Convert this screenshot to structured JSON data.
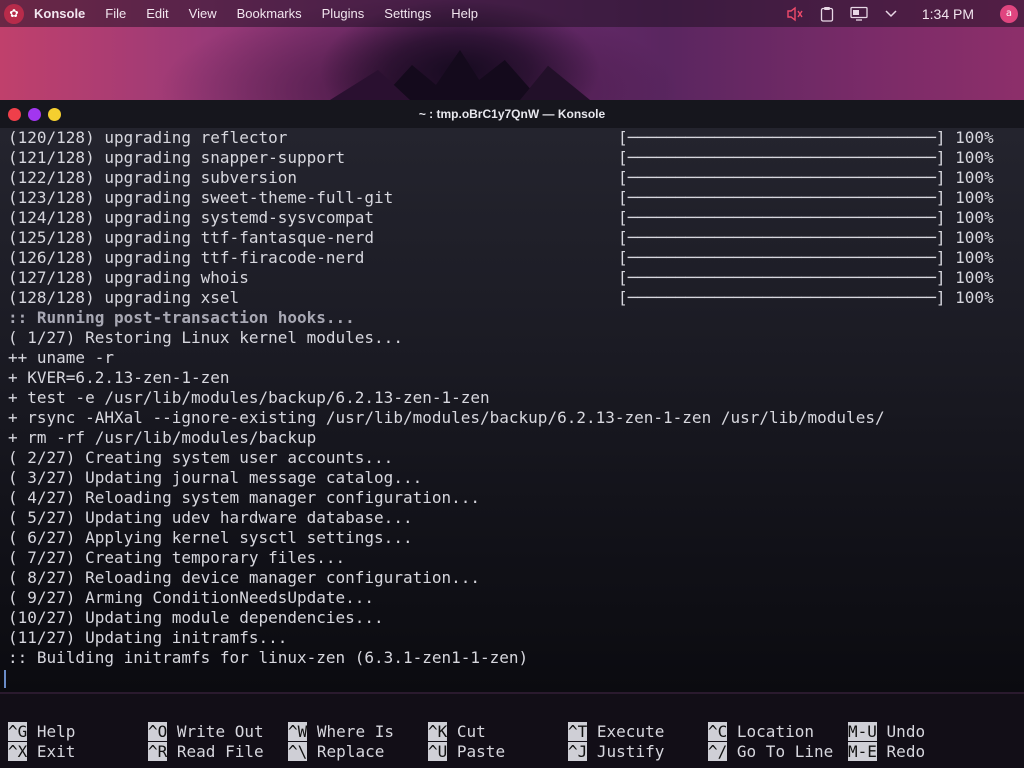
{
  "panel": {
    "app_name": "Konsole",
    "menu": [
      "File",
      "Edit",
      "View",
      "Bookmarks",
      "Plugins",
      "Settings",
      "Help"
    ],
    "clock": "1:34 PM",
    "avatar_letter": "a"
  },
  "window": {
    "title": "~ : tmp.oBrC1y7QnW — Konsole"
  },
  "terminal": {
    "upgrade_lines": [
      {
        "text": "(120/128) upgrading reflector",
        "percent": "100%"
      },
      {
        "text": "(121/128) upgrading snapper-support",
        "percent": "100%"
      },
      {
        "text": "(122/128) upgrading subversion",
        "percent": "100%"
      },
      {
        "text": "(123/128) upgrading sweet-theme-full-git",
        "percent": "100%"
      },
      {
        "text": "(124/128) upgrading systemd-sysvcompat",
        "percent": "100%"
      },
      {
        "text": "(125/128) upgrading ttf-fantasque-nerd",
        "percent": "100%"
      },
      {
        "text": "(126/128) upgrading ttf-firacode-nerd",
        "percent": "100%"
      },
      {
        "text": "(127/128) upgrading whois",
        "percent": "100%"
      },
      {
        "text": "(128/128) upgrading xsel",
        "percent": "100%"
      }
    ],
    "hooks_line": ":: Running post-transaction hooks...",
    "lines": [
      "( 1/27) Restoring Linux kernel modules...",
      "++ uname -r",
      "+ KVER=6.2.13-zen-1-zen",
      "+ test -e /usr/lib/modules/backup/6.2.13-zen-1-zen",
      "+ rsync -AHXal --ignore-existing /usr/lib/modules/backup/6.2.13-zen-1-zen /usr/lib/modules/",
      "+ rm -rf /usr/lib/modules/backup",
      "( 2/27) Creating system user accounts...",
      "( 3/27) Updating journal message catalog...",
      "( 4/27) Reloading system manager configuration...",
      "( 5/27) Updating udev hardware database...",
      "( 6/27) Applying kernel sysctl settings...",
      "( 7/27) Creating temporary files...",
      "( 8/27) Reloading device manager configuration...",
      "( 9/27) Arming ConditionNeedsUpdate...",
      "(10/27) Updating module dependencies...",
      "(11/27) Updating initramfs...",
      ":: Building initramfs for linux-zen (6.3.1-zen1-1-zen)"
    ]
  },
  "shortcuts": [
    {
      "key": "^G",
      "label": "Help"
    },
    {
      "key": "^X",
      "label": "Exit"
    },
    {
      "key": "^O",
      "label": "Write Out"
    },
    {
      "key": "^R",
      "label": "Read File"
    },
    {
      "key": "^W",
      "label": "Where Is"
    },
    {
      "key": "^\\",
      "label": "Replace"
    },
    {
      "key": "^K",
      "label": "Cut"
    },
    {
      "key": "^U",
      "label": "Paste"
    },
    {
      "key": "^T",
      "label": "Execute"
    },
    {
      "key": "^J",
      "label": "Justify"
    },
    {
      "key": "^C",
      "label": "Location"
    },
    {
      "key": "^/",
      "label": "Go To Line"
    },
    {
      "key": "M-U",
      "label": "Undo"
    },
    {
      "key": "M-E",
      "label": "Redo"
    }
  ],
  "colors": {
    "close": "#ef3f4a",
    "minimize": "#a236ef",
    "maximize": "#f5cf2f"
  }
}
